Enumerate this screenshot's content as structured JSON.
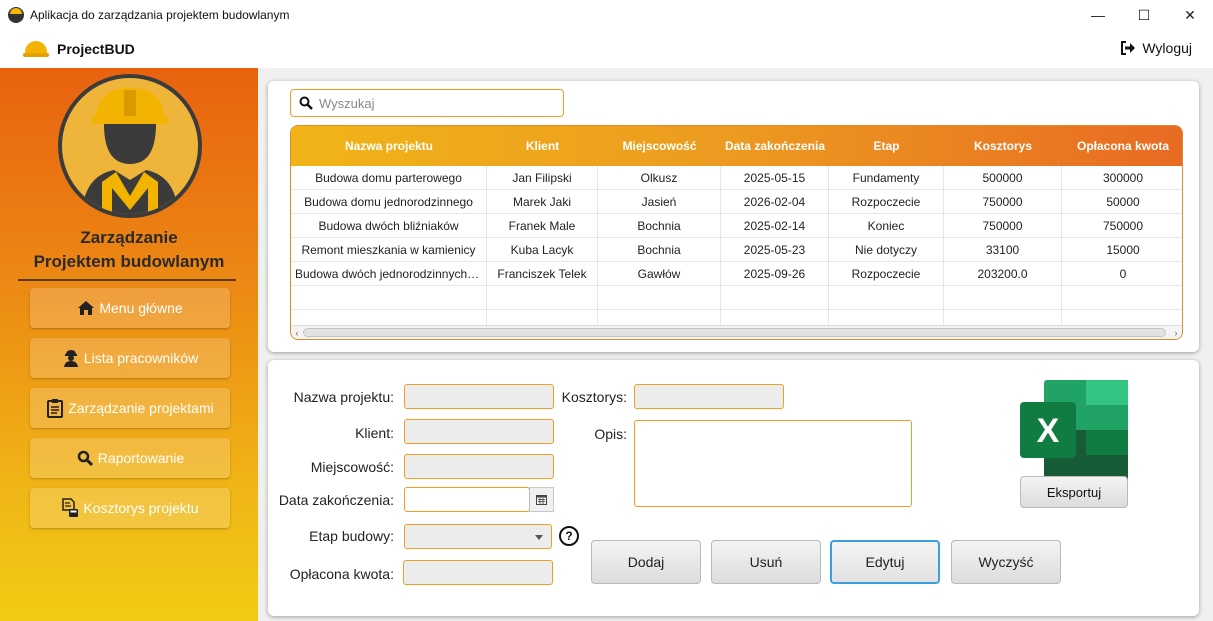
{
  "window": {
    "title": "Aplikacja do zarządzania projektem budowlanym",
    "controls": {
      "minimize": "—",
      "maximize": "☐",
      "close": "✕"
    }
  },
  "header": {
    "brand": "ProjectBUD",
    "logout_label": "Wyloguj"
  },
  "sidebar": {
    "title_line1": "Zarządzanie",
    "title_line2": "Projektem budowlanym",
    "items": [
      {
        "label": "Menu główne",
        "icon": "home-icon"
      },
      {
        "label": "Lista pracowników",
        "icon": "worker-icon"
      },
      {
        "label": "Zarządzanie projektami",
        "icon": "clipboard-icon"
      },
      {
        "label": "Raportowanie",
        "icon": "search-icon"
      },
      {
        "label": "Kosztorys projektu",
        "icon": "document-calculator-icon"
      }
    ]
  },
  "search": {
    "placeholder": "Wyszukaj",
    "value": ""
  },
  "table": {
    "columns": [
      "Nazwa projektu",
      "Klient",
      "Miejscowość",
      "Data zakończenia",
      "Etap",
      "Kosztorys",
      "Opłacona kwota"
    ],
    "rows": [
      [
        "Budowa domu parterowego",
        "Jan Filipski",
        "Olkusz",
        "2025-05-15",
        "Fundamenty",
        "500000",
        "300000"
      ],
      [
        "Budowa domu jednorodzinnego",
        "Marek Jaki",
        "Jasień",
        "2026-02-04",
        "Rozpoczecie",
        "750000",
        "50000"
      ],
      [
        "Budowa dwóch bliźniaków",
        "Franek Male",
        "Bochnia",
        "2025-02-14",
        "Koniec",
        "750000",
        "750000"
      ],
      [
        "Remont mieszkania w kamienicy",
        "Kuba Lacyk",
        "Bochnia",
        "2025-05-23",
        "Nie dotyczy",
        "33100",
        "15000"
      ],
      [
        "Budowa dwóch jednorodzinnych domów",
        "Franciszek Telek",
        "Gawłów",
        "2025-09-26",
        "Rozpoczecie",
        "203200.0",
        "0"
      ]
    ]
  },
  "form": {
    "labels": {
      "project_name": "Nazwa projektu:",
      "client": "Klient:",
      "town": "Miejscowość:",
      "end_date": "Data zakończenia:",
      "stage": "Etap budowy:",
      "paid": "Opłacona kwota:",
      "estimate": "Kosztorys:",
      "description": "Opis:"
    },
    "help_glyph": "?"
  },
  "actions": {
    "add": "Dodaj",
    "delete": "Usuń",
    "edit": "Edytuj",
    "clear": "Wyczyść",
    "export": "Eksportuj"
  },
  "excel": {
    "letter": "X"
  },
  "colors": {
    "accent_orange": "#f0a020",
    "sidebar_top": "#e8620e",
    "sidebar_bottom": "#f2cc14",
    "excel_green": "#107c41",
    "focus_blue": "#3aa0e0"
  }
}
